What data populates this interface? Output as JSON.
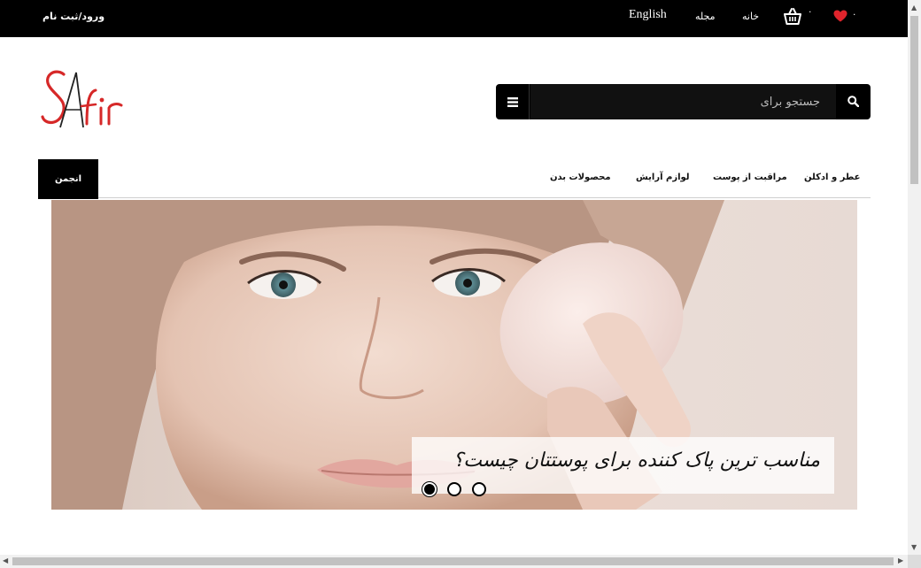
{
  "topbar": {
    "login_label": "ورود/ثبت نام",
    "language_label": "English",
    "magazine_label": "مجله",
    "home_label": "خانه",
    "basket_count": "۰",
    "wishlist_count": "۰",
    "basket_icon": "basket-icon",
    "heart_icon": "heart-icon",
    "heart_color": "#e0242c"
  },
  "logo": {
    "text": "SAfir",
    "brand_color": "#d62828"
  },
  "search": {
    "placeholder": "جستجو برای",
    "menu_icon": "hamburger-menu-icon",
    "search_icon": "search-icon"
  },
  "main_nav": {
    "forum_label": "انجمن",
    "items": [
      {
        "label": "عطر و ادکلن"
      },
      {
        "label": "مراقبت از پوست"
      },
      {
        "label": "لوازم آرایش"
      },
      {
        "label": "محصولات بدن"
      }
    ]
  },
  "slider": {
    "caption": "مناسب ترین پاک کننده برای پوستتان چیست؟",
    "dots": [
      {
        "active": true
      },
      {
        "active": false
      },
      {
        "active": false
      }
    ]
  }
}
